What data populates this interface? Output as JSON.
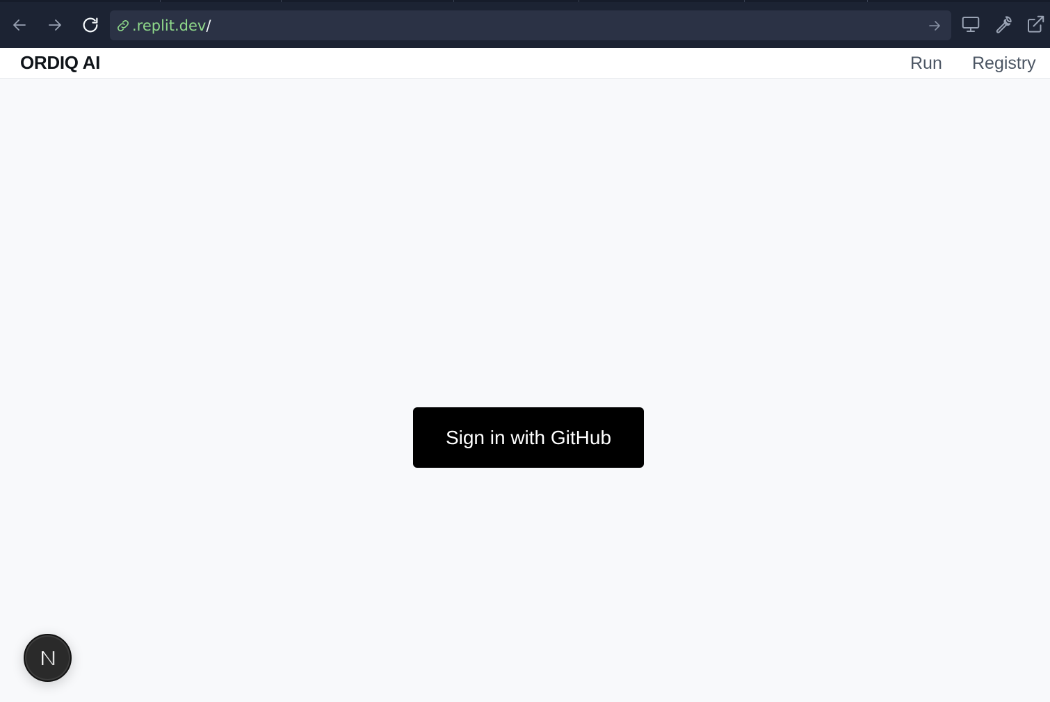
{
  "browser": {
    "url_domain": ".replit.dev",
    "url_path": "/",
    "icons": {
      "back": "arrow-left-icon",
      "forward": "arrow-right-icon",
      "reload": "reload-icon",
      "link": "link-icon",
      "go": "arrow-right-icon",
      "devtools_display": "monitor-icon",
      "tools": "wrench-icon",
      "open_new_tab": "external-link-icon"
    },
    "colors": {
      "chrome_bg": "#1c2333",
      "urlbar_bg": "#2b3245",
      "url_domain": "#8fd98a"
    }
  },
  "header": {
    "brand": "ORDIQ AI",
    "nav": [
      {
        "label": "Run"
      },
      {
        "label": "Registry"
      }
    ]
  },
  "main": {
    "signin_label": "Sign in with GitHub"
  },
  "badge": {
    "letter": "N",
    "icon": "nextjs-icon"
  }
}
